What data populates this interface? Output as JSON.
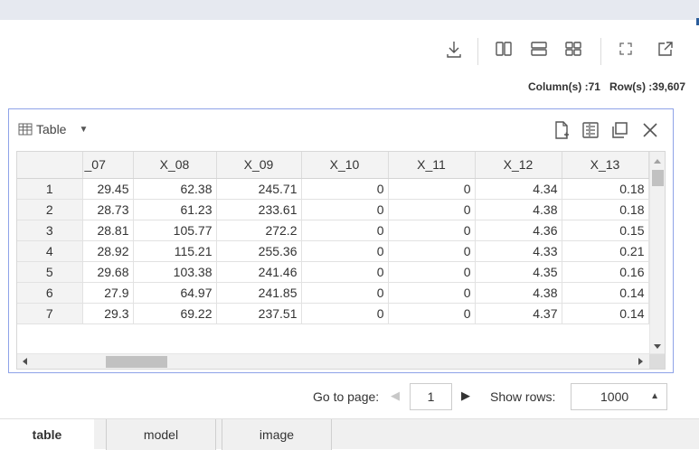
{
  "meta": {
    "columns": "Column(s) :71",
    "rows": "Row(s) :39,607"
  },
  "panel": {
    "title": "Table"
  },
  "table": {
    "headers": [
      "",
      "_07",
      "X_08",
      "X_09",
      "X_10",
      "X_11",
      "X_12",
      "X_13"
    ],
    "rows": [
      [
        "1",
        "29.45",
        "62.38",
        "245.71",
        "0",
        "0",
        "4.34",
        "0.18"
      ],
      [
        "2",
        "28.73",
        "61.23",
        "233.61",
        "0",
        "0",
        "4.38",
        "0.18"
      ],
      [
        "3",
        "28.81",
        "105.77",
        "272.2",
        "0",
        "0",
        "4.36",
        "0.15"
      ],
      [
        "4",
        "28.92",
        "115.21",
        "255.36",
        "0",
        "0",
        "4.33",
        "0.21"
      ],
      [
        "5",
        "29.68",
        "103.38",
        "241.46",
        "0",
        "0",
        "4.35",
        "0.16"
      ],
      [
        "6",
        "27.9",
        "64.97",
        "241.85",
        "0",
        "0",
        "4.38",
        "0.14"
      ],
      [
        "7",
        "29.3",
        "69.22",
        "237.51",
        "0",
        "0",
        "4.37",
        "0.14"
      ]
    ]
  },
  "pager": {
    "goto_label": "Go to page:",
    "page": "1",
    "show_rows_label": "Show rows:",
    "show_rows": "1000"
  },
  "tabs": [
    "table",
    "model",
    "image"
  ],
  "icons": {
    "toolbar": [
      "download-icon",
      "columns-layout-icon",
      "rows-layout-icon",
      "grid-layout-icon",
      "fullscreen-icon",
      "open-external-icon"
    ],
    "panel": [
      "new-file-icon",
      "form-icon",
      "duplicate-icon",
      "close-icon"
    ]
  }
}
